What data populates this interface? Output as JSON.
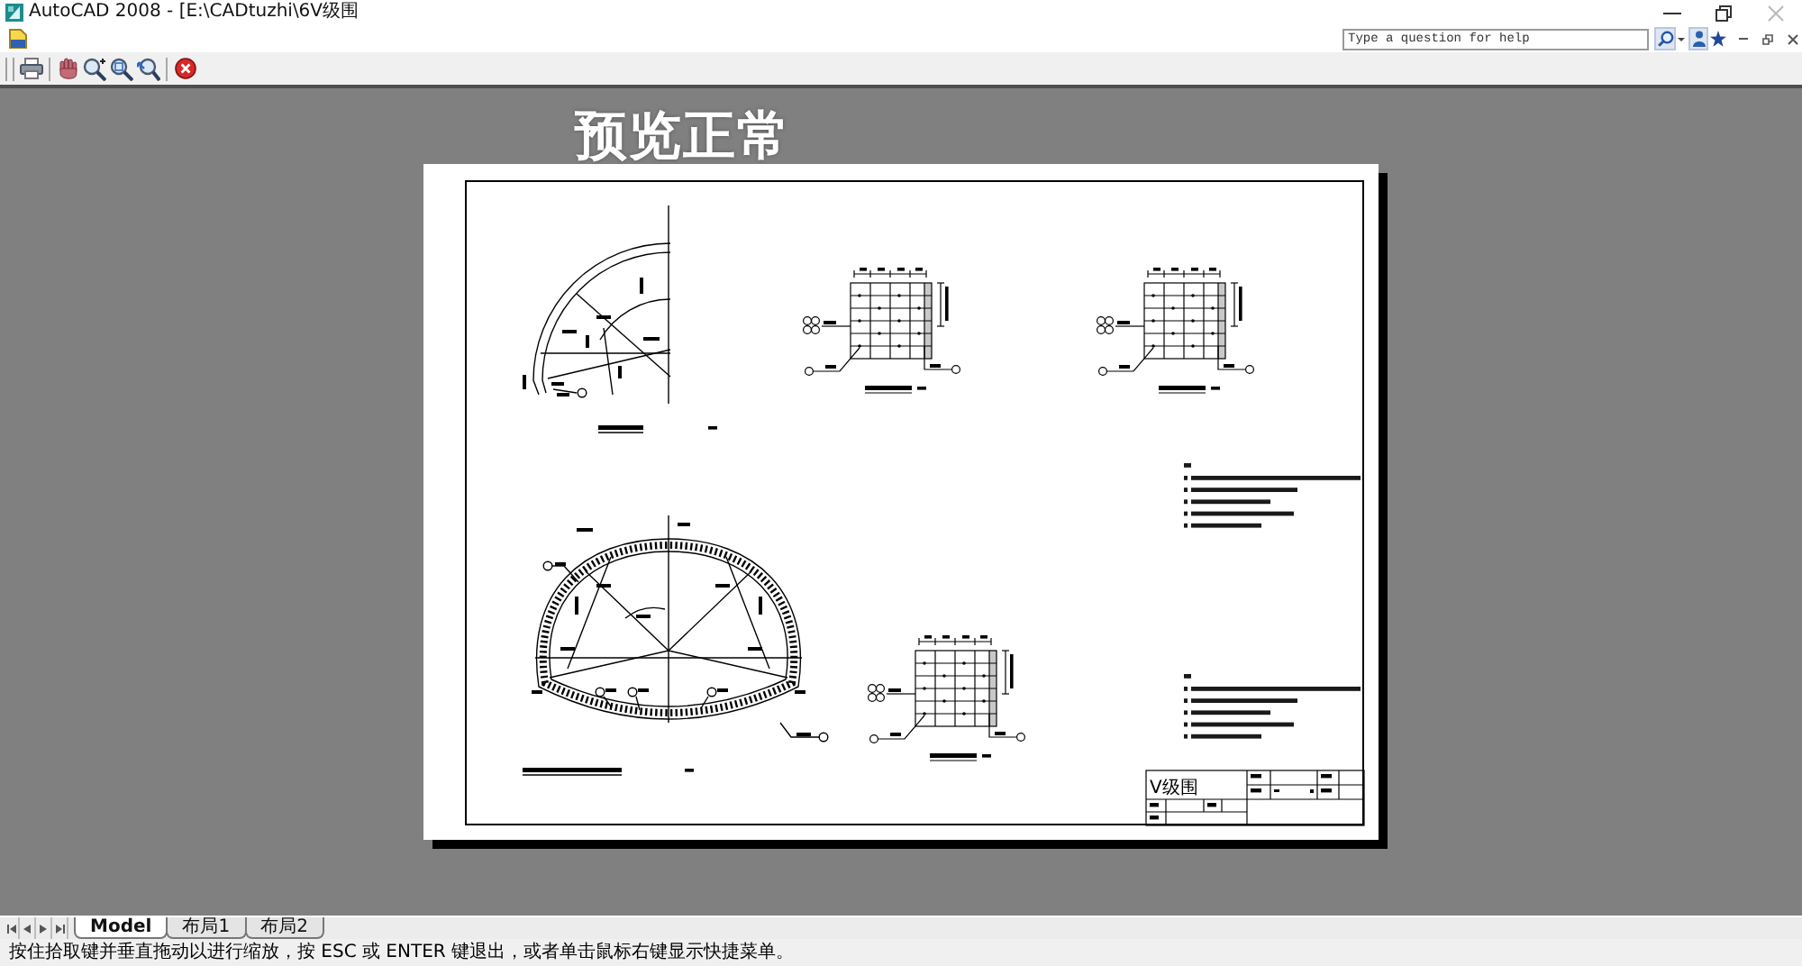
{
  "window": {
    "title": "AutoCAD 2008 - [E:\\CADtuzhi\\6Ⅴ级围"
  },
  "help_search": {
    "placeholder": "Type a question for help"
  },
  "annotation": {
    "text": "预览正常"
  },
  "sheet": {
    "title_block_label": "Ⅴ级围"
  },
  "layout_tabs": [
    {
      "label": "Model",
      "selected": true
    },
    {
      "label": "布局1",
      "selected": false
    },
    {
      "label": "布局2",
      "selected": false
    }
  ],
  "status_bar": {
    "prompt": "按住拾取键并垂直拖动以进行缩放，按 ESC 或 ENTER 键退出，或者单击鼠标右键显示快捷菜单。"
  }
}
